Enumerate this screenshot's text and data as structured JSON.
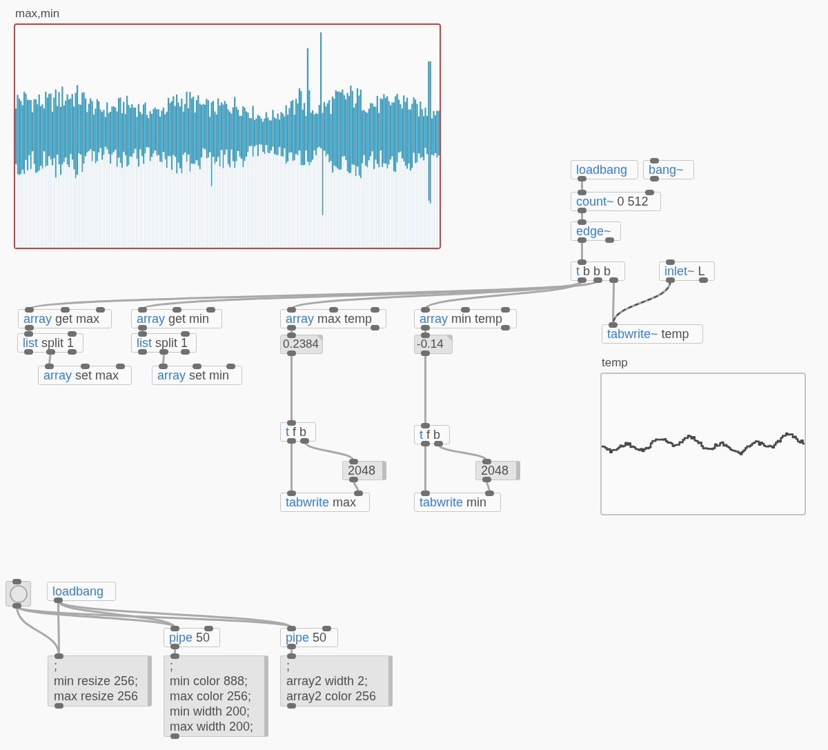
{
  "graphs": [
    {
      "kind": "bars",
      "name": "max,min",
      "selected": true
    },
    {
      "kind": "line",
      "name": "temp",
      "selected": false
    }
  ],
  "objects": [
    {
      "kind": "object",
      "text": "loadbang"
    },
    {
      "kind": "object",
      "text": "bang~"
    },
    {
      "kind": "object",
      "text": "count~ 0 512"
    },
    {
      "kind": "object",
      "text": "edge~"
    },
    {
      "kind": "object",
      "text": "t b b b"
    },
    {
      "kind": "object",
      "text": "inlet~ L"
    },
    {
      "kind": "object",
      "text": "array get max"
    },
    {
      "kind": "object",
      "text": "array get min"
    },
    {
      "kind": "object",
      "text": "array max temp"
    },
    {
      "kind": "object",
      "text": "array min temp"
    },
    {
      "kind": "object",
      "text": "tabwrite~ temp"
    },
    {
      "kind": "object",
      "text": "list split 1"
    },
    {
      "kind": "object",
      "text": "list split 1"
    },
    {
      "kind": "number",
      "value": "0.2384"
    },
    {
      "kind": "number",
      "value": "-0.14"
    },
    {
      "kind": "object",
      "text": "array set max"
    },
    {
      "kind": "object",
      "text": "array set min"
    },
    {
      "kind": "object",
      "text": "t f b"
    },
    {
      "kind": "object",
      "text": "t f b"
    },
    {
      "kind": "message",
      "lines": [
        "2048"
      ]
    },
    {
      "kind": "message",
      "lines": [
        "2048"
      ]
    },
    {
      "kind": "object",
      "text": "tabwrite max"
    },
    {
      "kind": "object",
      "text": "tabwrite min"
    },
    {
      "kind": "bang"
    },
    {
      "kind": "object",
      "text": "loadbang"
    },
    {
      "kind": "object",
      "text": "pipe 50"
    },
    {
      "kind": "object",
      "text": "pipe 50"
    },
    {
      "kind": "message",
      "lines": [
        ";",
        "min resize 256;",
        "max resize 256"
      ]
    },
    {
      "kind": "message",
      "lines": [
        ";",
        "min color 888;",
        "max color 256;",
        "min width 200;",
        "max width 200;"
      ]
    },
    {
      "kind": "message",
      "lines": [
        ";",
        "array2 width 2;",
        "array2 color 256"
      ]
    }
  ]
}
